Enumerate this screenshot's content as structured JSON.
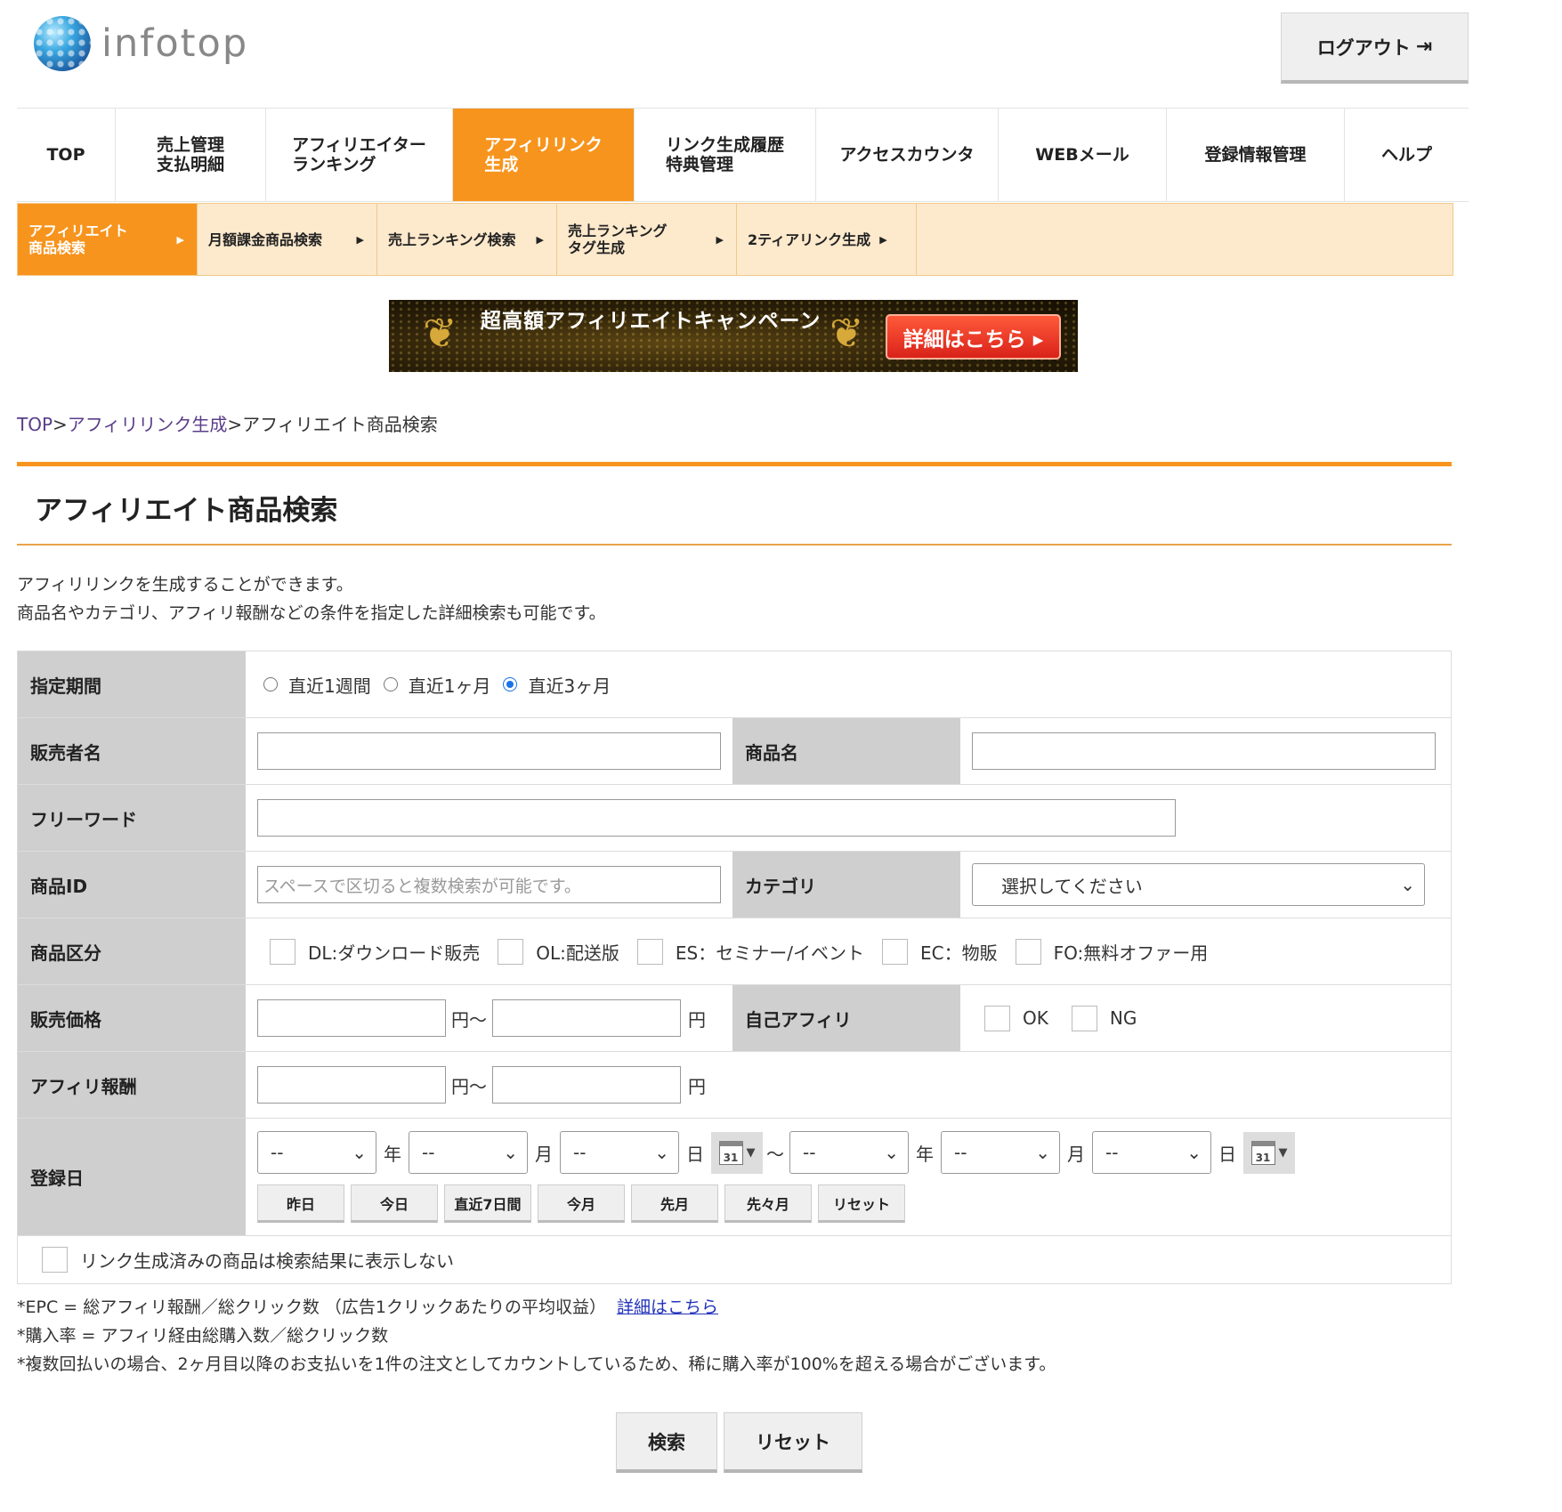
{
  "header": {
    "logo_text": "infotop",
    "logout_label": "ログアウト",
    "logout_icon": "logout-icon"
  },
  "main_nav": [
    {
      "label": "TOP",
      "active": false
    },
    {
      "label": "売上管理\n支払明細",
      "active": false
    },
    {
      "label": "アフィリエイター\nランキング",
      "active": false
    },
    {
      "label": "アフィリリンク\n生成",
      "active": true
    },
    {
      "label": "リンク生成履歴\n特典管理",
      "active": false
    },
    {
      "label": "アクセスカウンタ",
      "active": false
    },
    {
      "label": "WEBメール",
      "active": false
    },
    {
      "label": "登録情報管理",
      "active": false
    },
    {
      "label": "ヘルプ",
      "active": false
    }
  ],
  "sub_nav": [
    {
      "label": "アフィリエイト\n商品検索",
      "active": true
    },
    {
      "label": "月額課金商品検索",
      "active": false
    },
    {
      "label": "売上ランキング検索",
      "active": false
    },
    {
      "label": "売上ランキング\nタグ生成",
      "active": false
    },
    {
      "label": "2ティアリンク生成",
      "active": false
    }
  ],
  "banner": {
    "title": "超高額アフィリエイトキャンペーン",
    "button": "詳細はこちら ▸"
  },
  "breadcrumb": {
    "top": "TOP",
    "sep1": ">",
    "mid": "アフィリリンク生成",
    "sep2": ">",
    "current": "アフィリエイト商品検索"
  },
  "page_title": "アフィリエイト商品検索",
  "description": [
    "アフィリリンクを生成することができます。",
    "商品名やカテゴリ、アフィリ報酬などの条件を指定した詳細検索も可能です。"
  ],
  "form": {
    "period": {
      "label": "指定期間",
      "options": [
        "直近1週間",
        "直近1ヶ月",
        "直近3ヶ月"
      ],
      "selected": "直近3ヶ月"
    },
    "seller": {
      "label": "販売者名",
      "value": ""
    },
    "product_name": {
      "label": "商品名",
      "value": ""
    },
    "free_word": {
      "label": "フリーワード",
      "value": ""
    },
    "product_id": {
      "label": "商品ID",
      "placeholder": "スペースで区切ると複数検索が可能です。"
    },
    "category": {
      "label": "カテゴリ",
      "selected": "選択してください"
    },
    "product_type": {
      "label": "商品区分",
      "options": [
        "DL:ダウンロード販売",
        "OL:配送版",
        "ES：セミナー/イベント",
        "EC：物販",
        "FO:無料オファー用"
      ]
    },
    "price": {
      "label": "販売価格",
      "unit_from": "円〜",
      "unit_to": "円"
    },
    "self_affiliate": {
      "label": "自己アフィリ",
      "options": [
        "OK",
        "NG"
      ]
    },
    "reward": {
      "label": "アフィリ報酬",
      "unit_from": "円〜",
      "unit_to": "円"
    },
    "reg_date": {
      "label": "登録日",
      "placeholder": "--",
      "year": "年",
      "month": "月",
      "day": "日",
      "tilde": "〜",
      "cal_day": "31",
      "quick": [
        "昨日",
        "今日",
        "直近7日間",
        "今月",
        "先月",
        "先々月",
        "リセット"
      ]
    },
    "exclude_label": "リンク生成済みの商品は検索結果に表示しない"
  },
  "notes": {
    "epc": "*EPC = 総アフィリ報酬／総クリック数 （広告1クリックあたりの平均収益）",
    "epc_link": "詳細はこちら",
    "rate": "*購入率 = アフィリ経由総購入数／総クリック数",
    "multi": "*複数回払いの場合、2ヶ月目以降のお支払いを1件の注文としてカウントしているため、稀に購入率が100%を超える場合がございます。"
  },
  "buttons": {
    "search": "検索",
    "reset": "リセット"
  },
  "colors": {
    "accent": "#f7941d",
    "subnav_bg": "#fde9cc",
    "th_bg": "#cfcfcf"
  }
}
